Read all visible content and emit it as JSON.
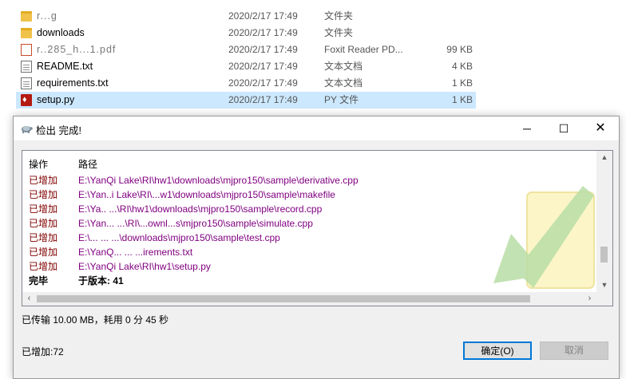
{
  "files": [
    {
      "name": "r...g",
      "date": "2020/2/17 17:49",
      "type": "文件夹",
      "size": "",
      "icon": "folder-icon"
    },
    {
      "name": "downloads",
      "date": "2020/2/17 17:49",
      "type": "文件夹",
      "size": "",
      "icon": "folder-icon"
    },
    {
      "name": "r..285_h...1.pdf",
      "date": "2020/2/17 17:49",
      "type": "Foxit Reader PD...",
      "size": "99 KB",
      "icon": "pdf-icon"
    },
    {
      "name": "README.txt",
      "date": "2020/2/17 17:49",
      "type": "文本文档",
      "size": "4 KB",
      "icon": "text-document-icon"
    },
    {
      "name": "requirements.txt",
      "date": "2020/2/17 17:49",
      "type": "文本文档",
      "size": "1 KB",
      "icon": "text-document-icon"
    },
    {
      "name": "setup.py",
      "date": "2020/2/17 17:49",
      "type": "PY 文件",
      "size": "1 KB",
      "icon": "python-file-icon"
    }
  ],
  "dialog": {
    "title": "检出 完成!",
    "window_buttons": {
      "minimize": "─",
      "maximize": "☐",
      "close": "✕"
    },
    "log_headers": {
      "operation": "操作",
      "path": "路径"
    },
    "log_rows": [
      {
        "op": "已增加",
        "path": "E:\\YanQi Lake\\RI\\hw1\\downloads\\mjpro150\\sample\\derivative.cpp"
      },
      {
        "op": "已增加",
        "path": "E:\\Yan..i Lake\\RI\\...w1\\downloads\\mjpro150\\sample\\makefile"
      },
      {
        "op": "已增加",
        "path": "E:\\Ya..   ...\\RI\\hw1\\downloads\\mjpro150\\sample\\record.cpp"
      },
      {
        "op": "已增加",
        "path": "E:\\Yan...  ...\\RI\\...ownl...s\\mjpro150\\sample\\simulate.cpp"
      },
      {
        "op": "已增加",
        "path": "E:\\...  ...  ...\\downloads\\mjpro150\\sample\\test.cpp"
      },
      {
        "op": "已增加",
        "path": "E:\\YanQ...  ...  ...irements.txt"
      },
      {
        "op": "已增加",
        "path": "E:\\YanQi Lake\\RI\\hw1\\setup.py"
      }
    ],
    "done_row": {
      "op": "完毕",
      "path": "于版本: 41"
    },
    "transfer_text": "已传输 10.00 MB，耗用 0 分 45 秒",
    "added_text": "已增加:72",
    "ok_button": "确定(O)",
    "cancel_button": "取消",
    "scroll_arrows": {
      "up": "▲",
      "down": "▼",
      "left": "‹",
      "right": "›"
    },
    "colors": {
      "added": "#800000",
      "path": "#800080",
      "accent": "#0078d7",
      "selected_row": "#cce8ff"
    }
  }
}
